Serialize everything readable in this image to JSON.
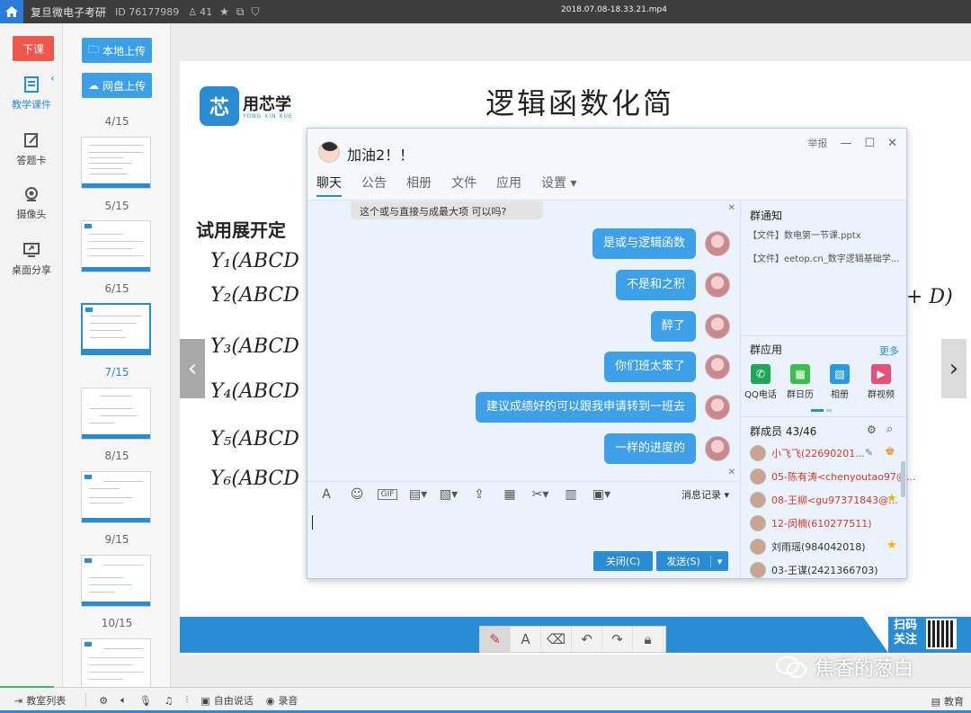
{
  "topbar": {
    "room_title": "复旦微电子考研",
    "room_id": "ID 76177989",
    "user_count": "41",
    "filename": "2018.07.08-18.33.21.mp4"
  },
  "leftbar": {
    "class_off_label": "下课",
    "items": [
      {
        "label": "教学课件",
        "icon": "courseware-icon"
      },
      {
        "label": "答题卡",
        "icon": "answer-card-icon"
      },
      {
        "label": "摄像头",
        "icon": "camera-icon"
      },
      {
        "label": "桌面分享",
        "icon": "screen-share-icon"
      }
    ]
  },
  "thumbnails": {
    "local_upload": "本地上传",
    "cloud_upload": "网盘上传",
    "pages": [
      "4/15",
      "5/15",
      "6/15",
      "7/15",
      "8/15",
      "9/15",
      "10/15"
    ],
    "active_page": "7/15"
  },
  "slide": {
    "logo_text": "用芯学",
    "logo_sub": "YONG XIN XUE",
    "title": "逻辑函数化简",
    "heading": "试用展开定",
    "lines": [
      "Y₁(ABCD",
      "Y₂(ABCD",
      "Y₃(ABCD",
      "Y₄(ABCD",
      "Y₅(ABCD",
      "Y₆(ABCD"
    ],
    "right_fragment": "+ D)",
    "footer_scan": "扫码",
    "footer_follow": "关注"
  },
  "chat": {
    "title": "加油2！！",
    "report": "举报",
    "tabs": [
      "聊天",
      "公告",
      "相册",
      "文件",
      "应用",
      "设置"
    ],
    "active_tab": "聊天",
    "cut_message": "这个或与直接与成最大项 可以吗?",
    "messages": [
      "是或与逻辑函数",
      "不是和之积",
      "醉了",
      "你们班太笨了",
      "建议成绩好的可以跟我申请转到一班去",
      "一样的进度的"
    ],
    "message_record": "消息记录",
    "close_btn": "关闭(C)",
    "send_btn": "发送(S)",
    "notice_title": "群通知",
    "notices": [
      "【文件】数电第一节课.pptx",
      "【文件】eetop.cn_数字逻辑基础学..."
    ],
    "apps_title": "群应用",
    "apps_more": "更多",
    "apps": [
      "QQ电话",
      "群日历",
      "相册",
      "群视频"
    ],
    "members_title": "群成员 43/46",
    "members": [
      {
        "name": "小飞飞(22690201...",
        "color": "#d93a2b"
      },
      {
        "name": "05-陈有涛<chenyoutao97@...",
        "color": "#d93a2b"
      },
      {
        "name": "08-王柳<gu97371843@...",
        "color": "#d93a2b"
      },
      {
        "name": "12-闵楠(610277511)",
        "color": "#d93a2b"
      },
      {
        "name": "刘雨瑶(984042018)",
        "color": "#333333"
      },
      {
        "name": "03-王谋(2421366703)",
        "color": "#333333"
      }
    ]
  },
  "bottombar": {
    "room_list": "教室列表",
    "free_talk": "自由说话",
    "record": "录音",
    "right_label": "教育"
  },
  "watermark": "焦香的葱白",
  "colors": {
    "accent": "#2a8dd4",
    "danger": "#f0574b",
    "chat_bubble": "#3da0e8"
  }
}
